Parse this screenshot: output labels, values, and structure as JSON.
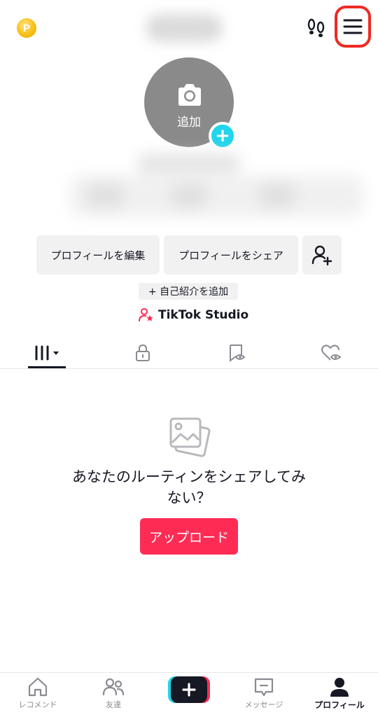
{
  "header": {
    "coin_glyph": "P",
    "icons": [
      "coin-icon",
      "footprints-icon",
      "hamburger-menu-icon"
    ]
  },
  "avatar": {
    "add_label": "追加",
    "plus_glyph": "+"
  },
  "actions": {
    "edit_profile": "プロフィールを編集",
    "share_profile": "プロフィールをシェア",
    "add_bio": "+ 自己紹介を追加",
    "studio": "TikTok Studio"
  },
  "tabs": [
    {
      "name": "videos",
      "icon": "grid-icon"
    },
    {
      "name": "private",
      "icon": "lock-icon"
    },
    {
      "name": "saved",
      "icon": "bookmark-icon"
    },
    {
      "name": "liked",
      "icon": "heart-icon"
    }
  ],
  "empty_state": {
    "line1": "あなたのルーティンをシェアしてみ",
    "line2": "ない？",
    "upload_label": "アップロード"
  },
  "bottom_nav": {
    "home": "レコメンド",
    "friends": "友達",
    "create_glyph": "+",
    "messages": "メッセージ",
    "profile": "プロフィール"
  },
  "colors": {
    "accent": "#fe2c55",
    "cyan": "#20d5ec",
    "highlight_ring": "#ee2a24"
  }
}
